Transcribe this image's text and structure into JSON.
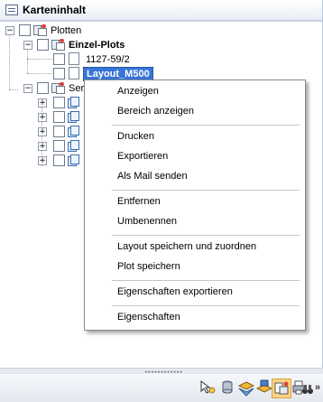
{
  "panel": {
    "title": "Karteninhalt"
  },
  "tree": {
    "root": {
      "label": "Plotten",
      "expander": "−"
    },
    "einzel": {
      "label": "Einzel-Plots",
      "expander": "−"
    },
    "items": [
      {
        "label": "1127-59/2"
      },
      {
        "label": "Layout_M500",
        "selected": true
      }
    ],
    "serien": {
      "label": "Seri",
      "expander": "−"
    },
    "serien_children_expander": "+",
    "serien_children_count": 5
  },
  "context_menu": {
    "groups": [
      [
        "Anzeigen",
        "Bereich anzeigen"
      ],
      [
        "Drucken",
        "Exportieren",
        "Als Mail senden"
      ],
      [
        "Entfernen",
        "Umbenennen"
      ],
      [
        "Layout speichern und zuordnen",
        "Plot speichern"
      ],
      [
        "Eigenschaften exportieren"
      ],
      [
        "Eigenschaften"
      ]
    ]
  },
  "toolbar": {
    "icons": [
      "cursor-icon",
      "database-icon",
      "layers-icon",
      "layer-edit-icon",
      "plot-icon",
      "print-icon",
      "binoculars-icon",
      "overflow-chevron-icon"
    ],
    "overflow": "»",
    "active": "plot-icon"
  },
  "colors": {
    "selection": "#3875d7",
    "active_tool": "#fbd48a"
  }
}
